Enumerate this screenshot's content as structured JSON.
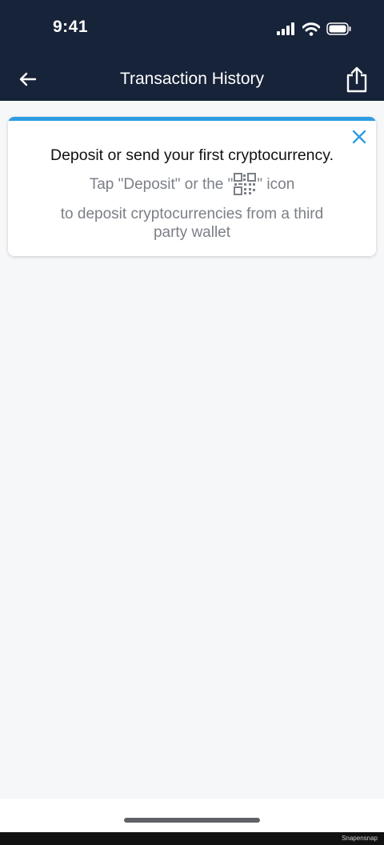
{
  "status_bar": {
    "time": "9:41",
    "icons": [
      "signal-icon",
      "wifi-icon",
      "battery-icon"
    ]
  },
  "header": {
    "title": "Transaction History",
    "back_icon": "back-arrow-icon",
    "share_icon": "share-icon",
    "background_color": "#172339"
  },
  "empty_state_card": {
    "title": "Deposit or send your first cryptocurrency.",
    "line1_prefix": "Tap \"Deposit\" or the \"",
    "line1_suffix": "\" icon",
    "line2": "to deposit cryptocurrencies from a third",
    "line3": "party wallet",
    "accent_color": "#2e9ce3",
    "close_icon": "close-icon",
    "inline_icon": "qr-code-icon"
  },
  "footer": {
    "watermark": "Snapensnap"
  }
}
